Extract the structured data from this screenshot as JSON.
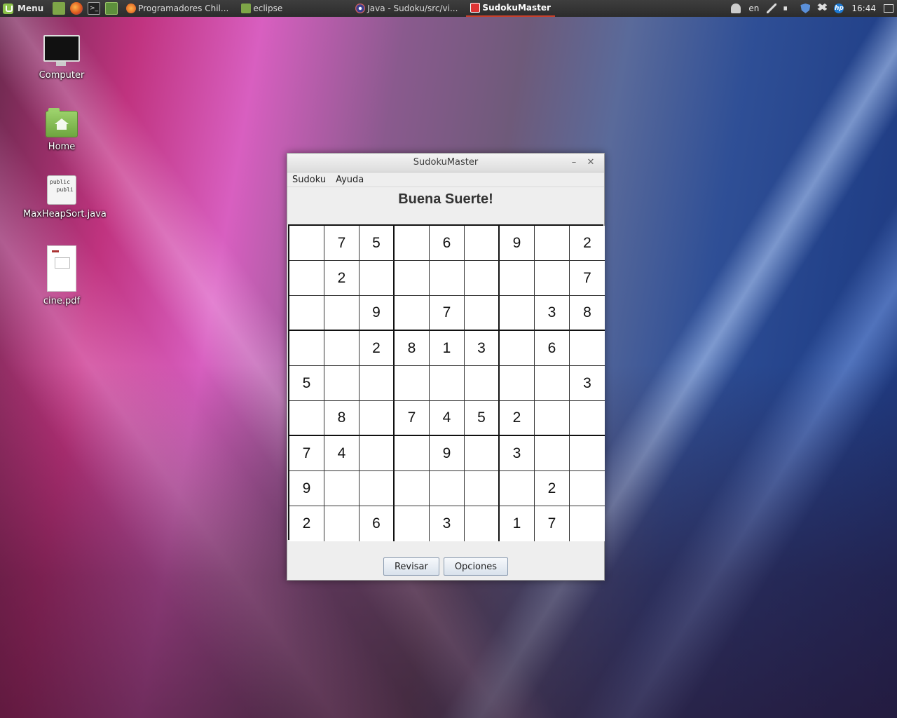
{
  "panel": {
    "menu_label": "Menu",
    "tasks": [
      {
        "label": "Programadores Chil...",
        "icon": "firefox-icon"
      },
      {
        "label": "eclipse",
        "icon": "folder-icon"
      },
      {
        "label": "Java - Sudoku/src/vi...",
        "icon": "eclipse-icon"
      },
      {
        "label": "SudokuMaster",
        "icon": "java-app-icon"
      }
    ],
    "language": "en",
    "clock": "16:44"
  },
  "desktop": {
    "icons": [
      {
        "label": "Computer"
      },
      {
        "label": "Home"
      },
      {
        "label": "MaxHeapSort.java",
        "preview": "public\n  publi"
      },
      {
        "label": "cine.pdf"
      }
    ]
  },
  "window": {
    "title": "SudokuMaster",
    "min_glyph": "–",
    "close_glyph": "✕",
    "menus": [
      "Sudoku",
      "Ayuda"
    ],
    "heading": "Buena Suerte!",
    "board": [
      [
        "",
        "7",
        "5",
        "",
        "6",
        "",
        "9",
        "",
        "2"
      ],
      [
        "",
        "2",
        "",
        "",
        "",
        "",
        "",
        "",
        "7"
      ],
      [
        "",
        "",
        "9",
        "",
        "7",
        "",
        "",
        "3",
        "8"
      ],
      [
        "",
        "",
        "2",
        "8",
        "1",
        "3",
        "",
        "6",
        ""
      ],
      [
        "5",
        "",
        "",
        "",
        "",
        "",
        "",
        "",
        "3"
      ],
      [
        "",
        "8",
        "",
        "7",
        "4",
        "5",
        "2",
        "",
        ""
      ],
      [
        "7",
        "4",
        "",
        "",
        "9",
        "",
        "3",
        "",
        ""
      ],
      [
        "9",
        "",
        "",
        "",
        "",
        "",
        "",
        "2",
        ""
      ],
      [
        "2",
        "",
        "6",
        "",
        "3",
        "",
        "1",
        "7",
        ""
      ]
    ],
    "buttons": {
      "check": "Revisar",
      "options": "Opciones"
    }
  }
}
